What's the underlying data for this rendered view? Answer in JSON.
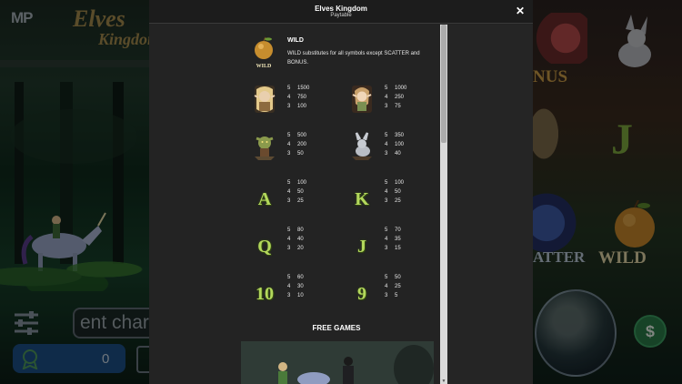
{
  "background": {
    "brand_logo": "MP",
    "game_logo_line1": "Elves",
    "game_logo_line2": "Kingdom",
    "bet_field_text": "ent char",
    "bonus_count": "0",
    "reel_labels": {
      "bonus": "NUS",
      "scatter": "ATTER",
      "wild": "WILD",
      "j": "J"
    }
  },
  "modal": {
    "title": "Elves Kingdom",
    "subtitle": "Paytable",
    "close_label": "✕",
    "wild": {
      "icon_label": "WILD",
      "heading": "WILD",
      "description": "WILD substitutes for all symbols except SCATTER and BONUS."
    },
    "paytable": [
      {
        "symbol": "blonde-elf-icon",
        "payouts": [
          [
            "5",
            "1500"
          ],
          [
            "4",
            "750"
          ],
          [
            "3",
            "100"
          ]
        ]
      },
      {
        "symbol": "elf-girl-icon",
        "payouts": [
          [
            "5",
            "1000"
          ],
          [
            "4",
            "250"
          ],
          [
            "3",
            "75"
          ]
        ]
      },
      {
        "symbol": "goblin-icon",
        "payouts": [
          [
            "5",
            "500"
          ],
          [
            "4",
            "200"
          ],
          [
            "3",
            "50"
          ]
        ]
      },
      {
        "symbol": "rabbit-icon",
        "payouts": [
          [
            "5",
            "350"
          ],
          [
            "4",
            "100"
          ],
          [
            "3",
            "40"
          ]
        ]
      },
      {
        "symbol": "A",
        "payouts": [
          [
            "5",
            "100"
          ],
          [
            "4",
            "50"
          ],
          [
            "3",
            "25"
          ]
        ]
      },
      {
        "symbol": "K",
        "payouts": [
          [
            "5",
            "100"
          ],
          [
            "4",
            "50"
          ],
          [
            "3",
            "25"
          ]
        ]
      },
      {
        "symbol": "Q",
        "payouts": [
          [
            "5",
            "80"
          ],
          [
            "4",
            "40"
          ],
          [
            "3",
            "20"
          ]
        ]
      },
      {
        "symbol": "J",
        "payouts": [
          [
            "5",
            "70"
          ],
          [
            "4",
            "35"
          ],
          [
            "3",
            "15"
          ]
        ]
      },
      {
        "symbol": "10",
        "payouts": [
          [
            "5",
            "60"
          ],
          [
            "4",
            "30"
          ],
          [
            "3",
            "10"
          ]
        ]
      },
      {
        "symbol": "9",
        "payouts": [
          [
            "5",
            "50"
          ],
          [
            "4",
            "25"
          ],
          [
            "3",
            "5"
          ]
        ]
      }
    ],
    "free_games_heading": "FREE GAMES",
    "scrollbar_arrow": "▼"
  },
  "colors": {
    "modal_bg": "#232323",
    "letter_symbol": "#b3d85c",
    "bonus_bar": "#1d4f85"
  }
}
